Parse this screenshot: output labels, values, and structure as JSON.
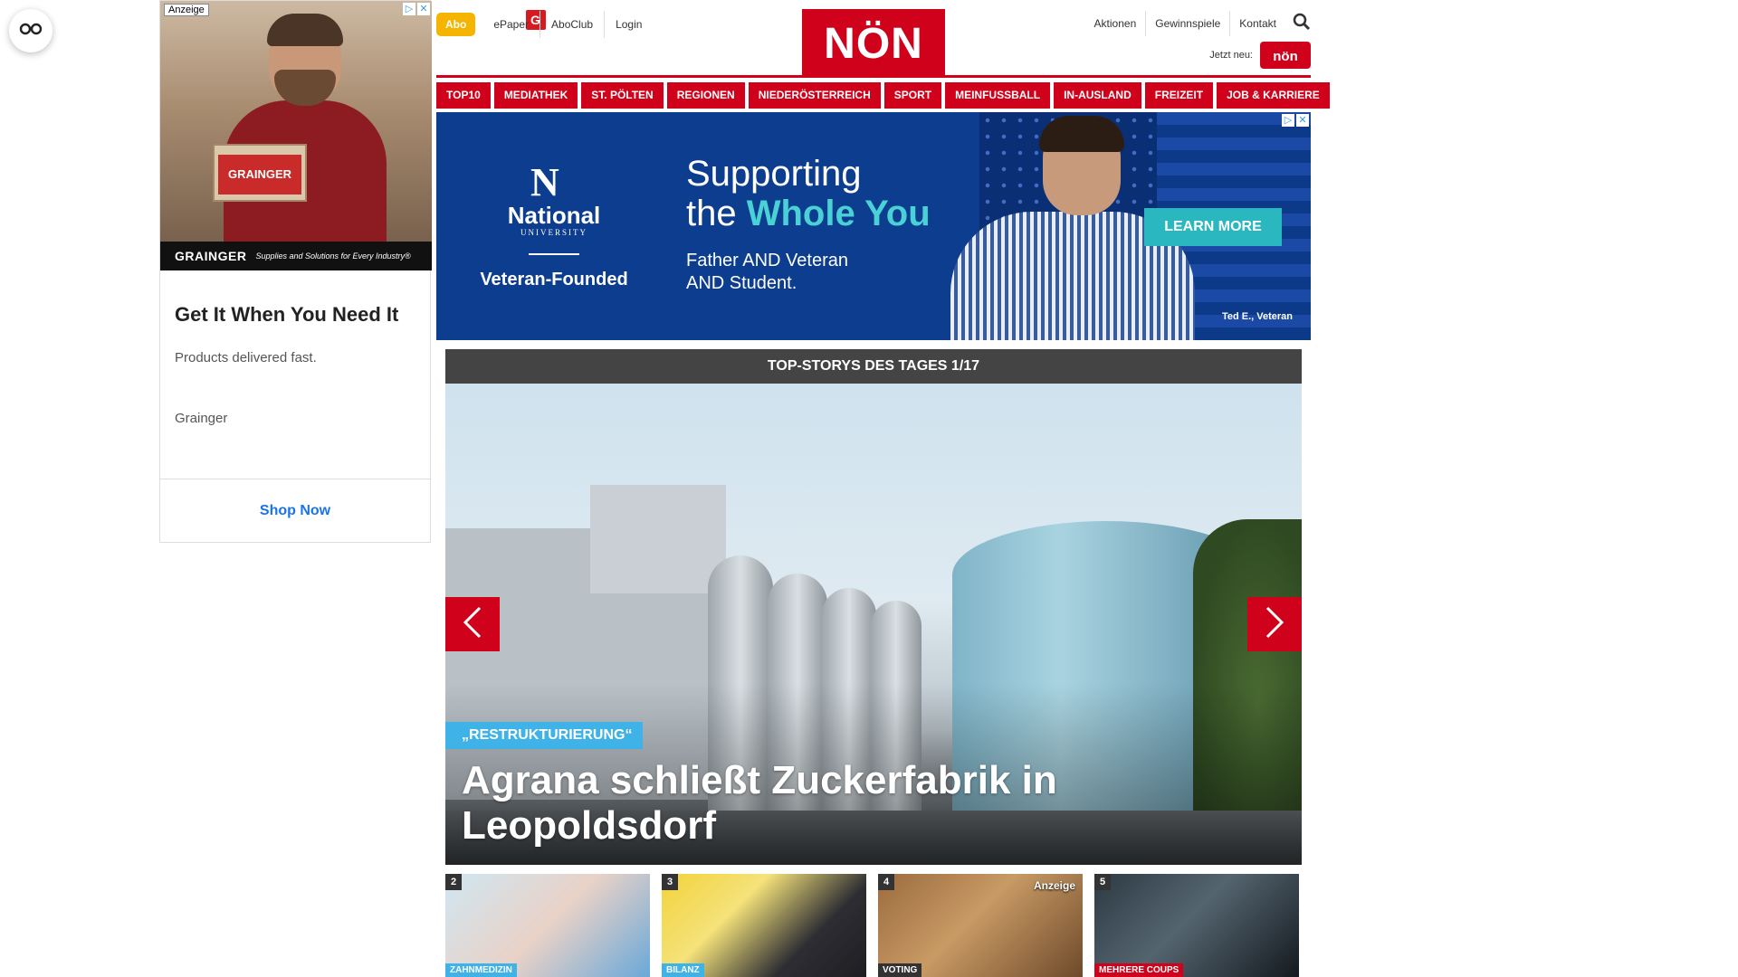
{
  "float_button": {
    "icon": "glasses-icon"
  },
  "side_ad": {
    "badge": "Anzeige",
    "box_label": "GRAINGER",
    "brand": "GRAINGER",
    "tagline": "Supplies and Solutions for Every Industry®",
    "headline": "Get It When You Need It",
    "description": "Products delivered fast.",
    "advertiser_initial": "G",
    "advertiser": "Grainger",
    "cta": "Shop Now"
  },
  "header": {
    "abo": "Abo",
    "links": [
      "ePaper",
      "AboClub",
      "Login"
    ],
    "logo": "NÖN",
    "right_links": [
      "Aktionen",
      "Gewinnspiele",
      "Kontakt"
    ],
    "jetzt_neu": "Jetzt neu:",
    "mini_logo": "nön"
  },
  "nav": [
    "TOP10",
    "MEDIATHEK",
    "ST. PÖLTEN",
    "REGIONEN",
    "NIEDERÖSTERREICH",
    "SPORT",
    "MEINFUSSBALL",
    "IN-AUSLAND",
    "FREIZEIT",
    "JOB & KARRIERE"
  ],
  "banner": {
    "nu_mark": "N",
    "nu_name": "National",
    "nu_sub": "UNIVERSITY",
    "nu_vet": "Veteran-Founded",
    "h1_line1": "Supporting",
    "h1_pre": "the ",
    "h1_highlight": "Whole You",
    "sub_line1": "Father AND Veteran",
    "sub_line2": "AND Student.",
    "cta": "LEARN MORE",
    "credit": "Ted E., Veteran"
  },
  "top_stories": {
    "bar": "TOP-STORYS DES TAGES 1/17",
    "kicker": "„RESTRUKTURIERUNG“",
    "title": "Agrana schließt Zuckerfabrik in Leopoldsdorf"
  },
  "thumbs": [
    {
      "num": "2",
      "tag": "ZAHNMEDIZIN",
      "tag_color": "#3fb3e8"
    },
    {
      "num": "3",
      "tag": "BILANZ",
      "tag_color": "#3fb3e8"
    },
    {
      "num": "4",
      "tag": "VOTING",
      "tag_color": "#333333",
      "anzeige": "Anzeige"
    },
    {
      "num": "5",
      "tag": "MEHRERE COUPS",
      "tag_color": "#d0021b"
    }
  ],
  "colors": {
    "brand_red": "#d0021b",
    "abo_yellow": "#f4b400",
    "kicker_blue": "#3fb3e8"
  }
}
